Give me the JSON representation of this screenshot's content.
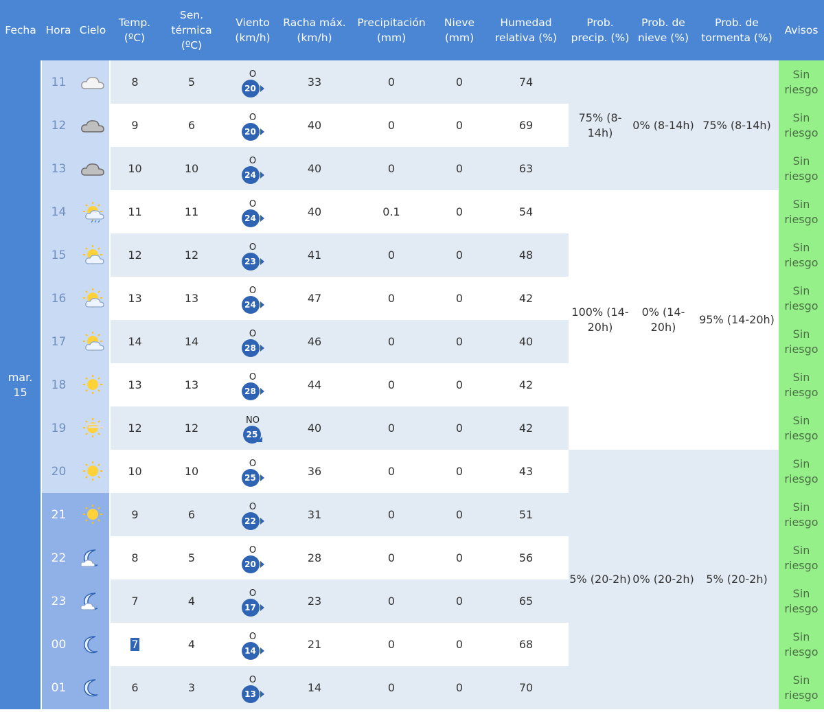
{
  "headers": {
    "fecha": "Fecha",
    "hora": "Hora",
    "cielo": "Cielo",
    "temp": [
      "Temp.",
      "(ºC)"
    ],
    "sens": [
      "Sen.",
      "térmica",
      "(ºC)"
    ],
    "viento": [
      "Viento",
      "(km/h)"
    ],
    "racha": [
      "Racha máx.",
      "(km/h)"
    ],
    "precip": [
      "Precipitación",
      "(mm)"
    ],
    "nieve": [
      "Nieve",
      "(mm)"
    ],
    "humedad": [
      "Humedad",
      "relativa (%)"
    ],
    "prob_precip": [
      "Prob.",
      "precip. (%)"
    ],
    "prob_nieve": [
      "Prob. de",
      "nieve (%)"
    ],
    "prob_tormenta": [
      "Prob. de",
      "tormenta (%)"
    ],
    "avisos": "Avisos"
  },
  "fecha": [
    "mar.",
    "15"
  ],
  "rows": [
    {
      "hora": "11",
      "sky": "cloud-icon",
      "temp": "8",
      "sens": "5",
      "wdir": "O",
      "wspeed": "20",
      "racha": "33",
      "precip": "0",
      "nieve": "0",
      "humedad": "74",
      "aviso": [
        "Sin",
        "riesgo"
      ]
    },
    {
      "hora": "12",
      "sky": "cloud-dark-icon",
      "temp": "9",
      "sens": "6",
      "wdir": "O",
      "wspeed": "20",
      "racha": "40",
      "precip": "0",
      "nieve": "0",
      "humedad": "69",
      "aviso": [
        "Sin",
        "riesgo"
      ]
    },
    {
      "hora": "13",
      "sky": "cloud-dark-icon",
      "temp": "10",
      "sens": "10",
      "wdir": "O",
      "wspeed": "24",
      "racha": "40",
      "precip": "0",
      "nieve": "0",
      "humedad": "63",
      "aviso": [
        "Sin",
        "riesgo"
      ]
    },
    {
      "hora": "14",
      "sky": "sun-cloud-rain-icon",
      "temp": "11",
      "sens": "11",
      "wdir": "O",
      "wspeed": "24",
      "racha": "40",
      "precip": "0.1",
      "nieve": "0",
      "humedad": "54",
      "aviso": [
        "Sin",
        "riesgo"
      ]
    },
    {
      "hora": "15",
      "sky": "sun-cloud-icon",
      "temp": "12",
      "sens": "12",
      "wdir": "O",
      "wspeed": "23",
      "racha": "41",
      "precip": "0",
      "nieve": "0",
      "humedad": "48",
      "aviso": [
        "Sin",
        "riesgo"
      ]
    },
    {
      "hora": "16",
      "sky": "sun-cloud-icon",
      "temp": "13",
      "sens": "13",
      "wdir": "O",
      "wspeed": "24",
      "racha": "47",
      "precip": "0",
      "nieve": "0",
      "humedad": "42",
      "aviso": [
        "Sin",
        "riesgo"
      ]
    },
    {
      "hora": "17",
      "sky": "sun-cloud-icon",
      "temp": "14",
      "sens": "14",
      "wdir": "O",
      "wspeed": "28",
      "racha": "46",
      "precip": "0",
      "nieve": "0",
      "humedad": "40",
      "aviso": [
        "Sin",
        "riesgo"
      ]
    },
    {
      "hora": "18",
      "sky": "sun-icon",
      "temp": "13",
      "sens": "13",
      "wdir": "O",
      "wspeed": "28",
      "racha": "44",
      "precip": "0",
      "nieve": "0",
      "humedad": "42",
      "aviso": [
        "Sin",
        "riesgo"
      ]
    },
    {
      "hora": "19",
      "sky": "sun-haze-icon",
      "temp": "12",
      "sens": "12",
      "wdir": "NO",
      "wspeed": "25",
      "racha": "40",
      "precip": "0",
      "nieve": "0",
      "humedad": "42",
      "aviso": [
        "Sin",
        "riesgo"
      ]
    },
    {
      "hora": "20",
      "sky": "sun-icon",
      "temp": "10",
      "sens": "10",
      "wdir": "O",
      "wspeed": "25",
      "racha": "36",
      "precip": "0",
      "nieve": "0",
      "humedad": "43",
      "aviso": [
        "Sin",
        "riesgo"
      ]
    },
    {
      "hora": "21",
      "sky": "sun-icon",
      "temp": "9",
      "sens": "6",
      "wdir": "O",
      "wspeed": "22",
      "racha": "31",
      "precip": "0",
      "nieve": "0",
      "humedad": "51",
      "aviso": [
        "Sin",
        "riesgo"
      ]
    },
    {
      "hora": "22",
      "sky": "moon-cloud-icon",
      "temp": "8",
      "sens": "5",
      "wdir": "O",
      "wspeed": "20",
      "racha": "28",
      "precip": "0",
      "nieve": "0",
      "humedad": "56",
      "aviso": [
        "Sin",
        "riesgo"
      ]
    },
    {
      "hora": "23",
      "sky": "moon-cloud-icon",
      "temp": "7",
      "sens": "4",
      "wdir": "O",
      "wspeed": "17",
      "racha": "23",
      "precip": "0",
      "nieve": "0",
      "humedad": "65",
      "aviso": [
        "Sin",
        "riesgo"
      ]
    },
    {
      "hora": "00",
      "sky": "moon-icon",
      "temp": "7",
      "sens": "4",
      "wdir": "O",
      "wspeed": "14",
      "racha": "21",
      "precip": "0",
      "nieve": "0",
      "humedad": "68",
      "aviso": [
        "Sin",
        "riesgo"
      ]
    },
    {
      "hora": "01",
      "sky": "moon-icon",
      "temp": "6",
      "sens": "3",
      "wdir": "O",
      "wspeed": "13",
      "racha": "14",
      "precip": "0",
      "nieve": "0",
      "humedad": "70",
      "aviso": [
        "Sin",
        "riesgo"
      ]
    }
  ],
  "groups": [
    {
      "prob_precip": [
        "75% (8-",
        "14h)"
      ],
      "prob_nieve": [
        "0% (8-14h)"
      ],
      "prob_tormenta": [
        "75% (8-14h)"
      ]
    },
    {
      "prob_precip": [
        "100% (14-",
        "20h)"
      ],
      "prob_nieve": [
        "0% (14-",
        "20h)"
      ],
      "prob_tormenta": [
        "95% (14-20h)"
      ]
    },
    {
      "prob_precip": [
        "5% (20-2h)"
      ],
      "prob_nieve": [
        "0% (20-2h)"
      ],
      "prob_tormenta": [
        "5% (20-2h)"
      ]
    }
  ],
  "colors": {
    "header": "#4a86d4",
    "aviso": "#96f08a",
    "badge": "#2f64b4"
  }
}
